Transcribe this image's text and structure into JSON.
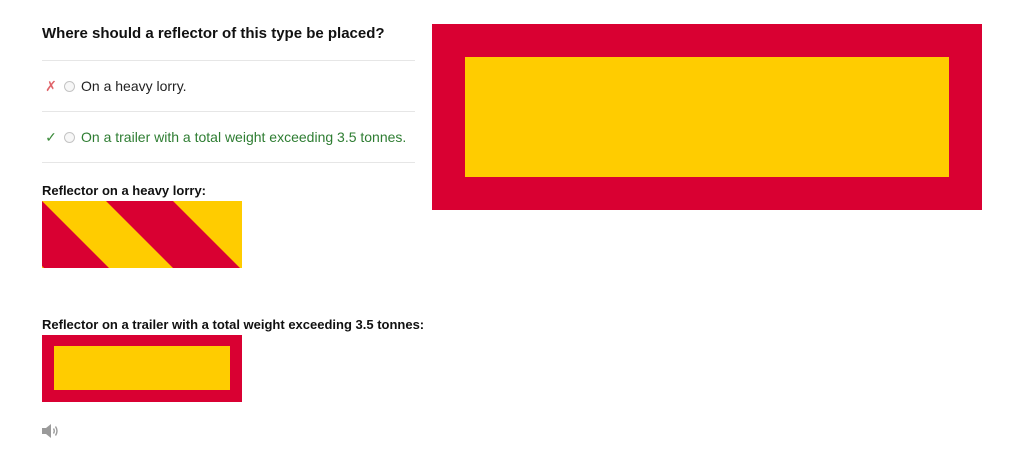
{
  "question": {
    "text": "Where should a reflector of this type be placed?"
  },
  "answers": [
    {
      "mark": "✗",
      "label": "On a heavy lorry.",
      "status": "wrong"
    },
    {
      "mark": "✓",
      "label": "On a trailer with a total weight exceeding 3.5 tonnes.",
      "status": "correct"
    }
  ],
  "explanation": {
    "lorry_caption": "Reflector on a heavy lorry:",
    "trailer_caption": "Reflector on a trailer with a total weight exceeding 3.5 tonnes:"
  },
  "colors": {
    "red": "#d90032",
    "yellow": "#ffcc00",
    "correct_text": "#2e7d32",
    "wrong_mark": "#e0646a"
  },
  "icons": {
    "audio": "speaker-icon"
  }
}
